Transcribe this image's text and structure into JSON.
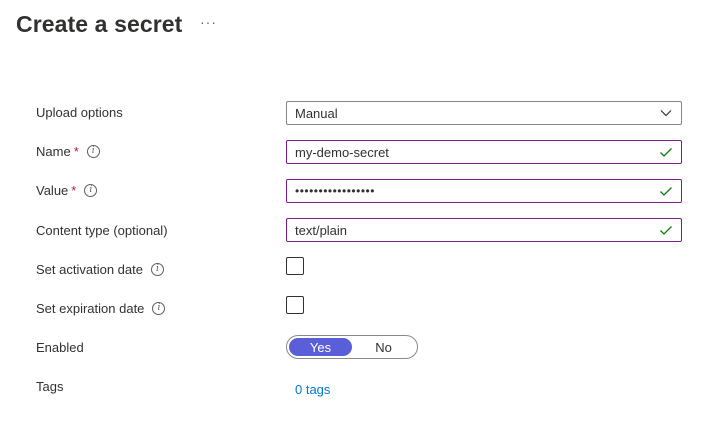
{
  "header": {
    "title": "Create a secret",
    "more_label": "···"
  },
  "form": {
    "upload_options": {
      "label": "Upload options",
      "value": "Manual"
    },
    "name": {
      "label": "Name",
      "required_mark": "*",
      "value": "my-demo-secret"
    },
    "value": {
      "label": "Value",
      "required_mark": "*",
      "value": "•••••••••••••••••"
    },
    "content_type": {
      "label": "Content type (optional)",
      "value": "text/plain"
    },
    "activation": {
      "label": "Set activation date",
      "checked": false
    },
    "expiration": {
      "label": "Set expiration date",
      "checked": false
    },
    "enabled": {
      "label": "Enabled",
      "yes": "Yes",
      "no": "No",
      "selected": "Yes"
    },
    "tags": {
      "label": "Tags",
      "link": "0 tags"
    }
  },
  "info_glyph": "i",
  "colors": {
    "accent": "#5a5ed9",
    "valid_border": "#7f1a8e",
    "link": "#0078d4",
    "required": "#a4262c",
    "check": "#107c10"
  }
}
